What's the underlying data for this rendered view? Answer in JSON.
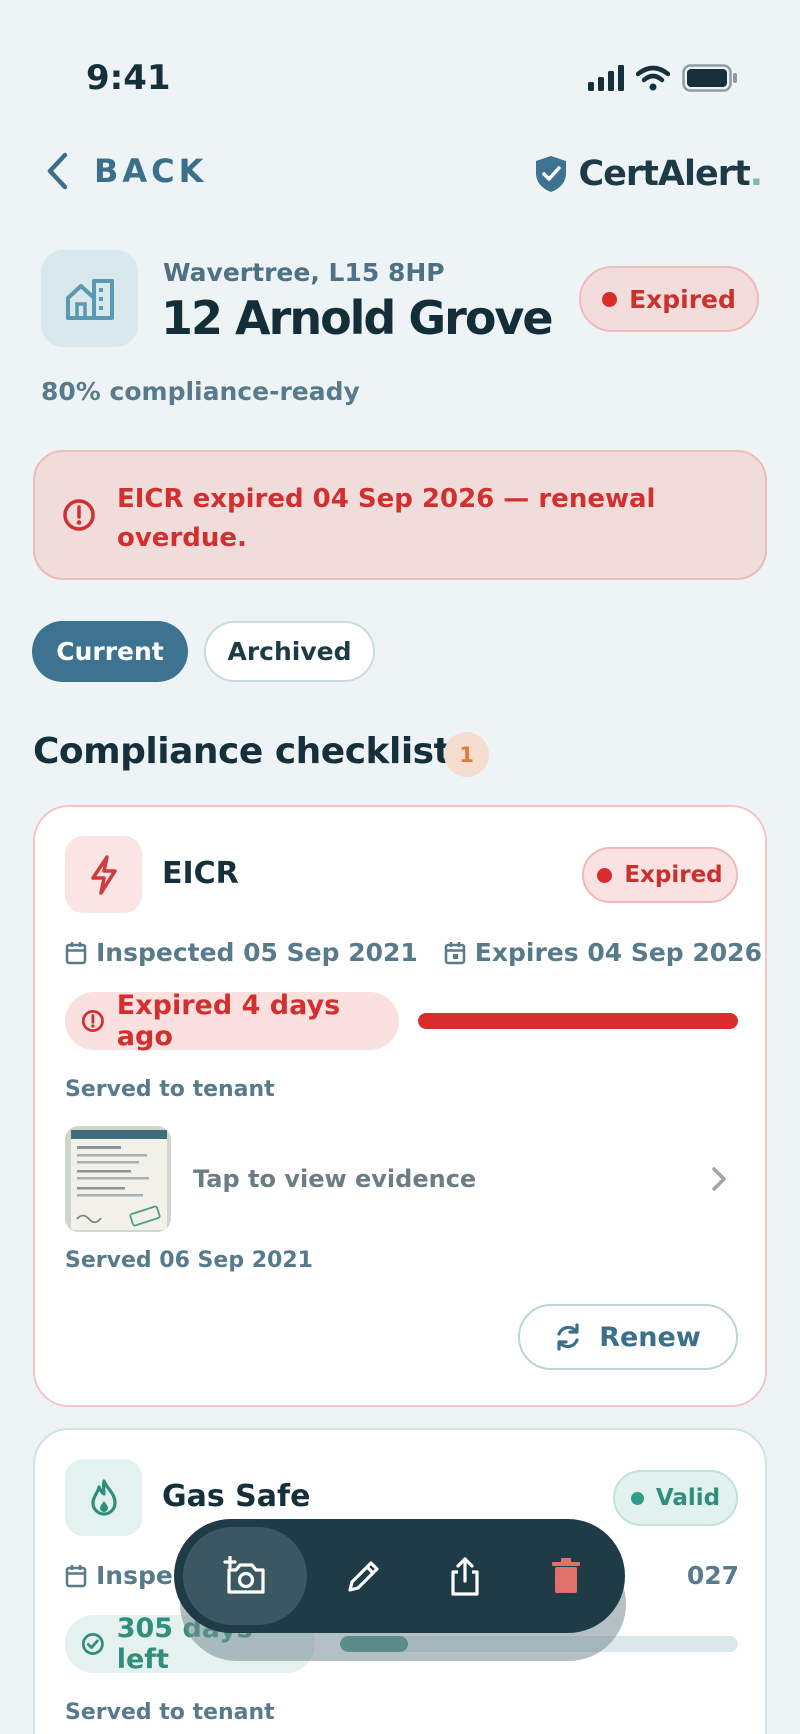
{
  "status_bar": {
    "time": "9:41"
  },
  "nav": {
    "back_label": "BACK",
    "brand_name": "CertAlert",
    "brand_dot": "."
  },
  "property": {
    "area": "Wavertree, L15 8HP",
    "name": "12 Arnold Grove",
    "status": "Expired",
    "compliance": "80% compliance-ready",
    "compliance_fraction": 0.8
  },
  "alert": {
    "message": "EICR expired 04 Sep 2026 — renewal overdue."
  },
  "tabs": [
    {
      "label": "Current",
      "selected": true
    },
    {
      "label": "Archived",
      "selected": false
    }
  ],
  "section": {
    "title": "Compliance checklist",
    "count": "1"
  },
  "certificates": [
    {
      "name": "EICR",
      "icon": "lightning-icon",
      "status": "Expired",
      "inspected": "Inspected 05 Sep 2021",
      "expires": "Expires 04 Sep 2026",
      "days_label": "Expired 4 days ago",
      "progress_fraction": 1.0,
      "served_label": "Served to tenant",
      "evidence_label": "Tap to view evidence",
      "served_date": "Served 06 Sep 2021",
      "renew_label": "Renew"
    },
    {
      "name": "Gas Safe",
      "icon": "flame-icon",
      "status": "Valid",
      "inspected": "Inspe",
      "expires": "027",
      "days_label": "305 days left",
      "progress_fraction": 0.17,
      "served_label": "Served to tenant"
    }
  ],
  "toolbar": {
    "actions": [
      "add-photo-icon",
      "edit-icon",
      "share-icon",
      "delete-icon"
    ]
  },
  "colors": {
    "background": "#eef4f5",
    "primary": "#3d7390",
    "danger": "#d22f2f",
    "success": "#2f8f7c",
    "accent": "#e07b3e",
    "toolbar": "#1f3b46"
  }
}
